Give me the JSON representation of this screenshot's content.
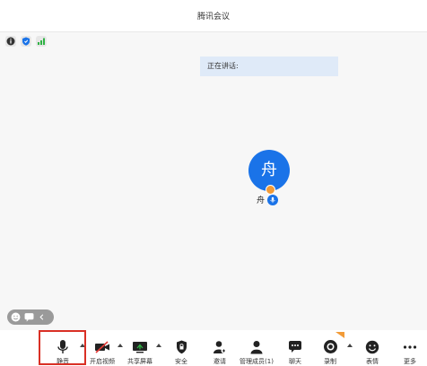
{
  "window": {
    "title": "腾讯会议"
  },
  "status_icons": [
    "info-icon",
    "shield-icon",
    "signal-icon"
  ],
  "speaking": {
    "label": "正在讲话:"
  },
  "participant": {
    "avatar_char": "舟",
    "name": "舟"
  },
  "toolbar": {
    "mute": "静音",
    "video": "开启视频",
    "share": "共享屏幕",
    "security": "安全",
    "invite": "邀请",
    "members": "管理成员(1)",
    "chat": "聊天",
    "record": "录制",
    "reaction": "表情",
    "more": "更多"
  },
  "colors": {
    "accent": "#1a73e8",
    "highlight": "#d93025",
    "speaking_bg": "#dfeaf8"
  }
}
